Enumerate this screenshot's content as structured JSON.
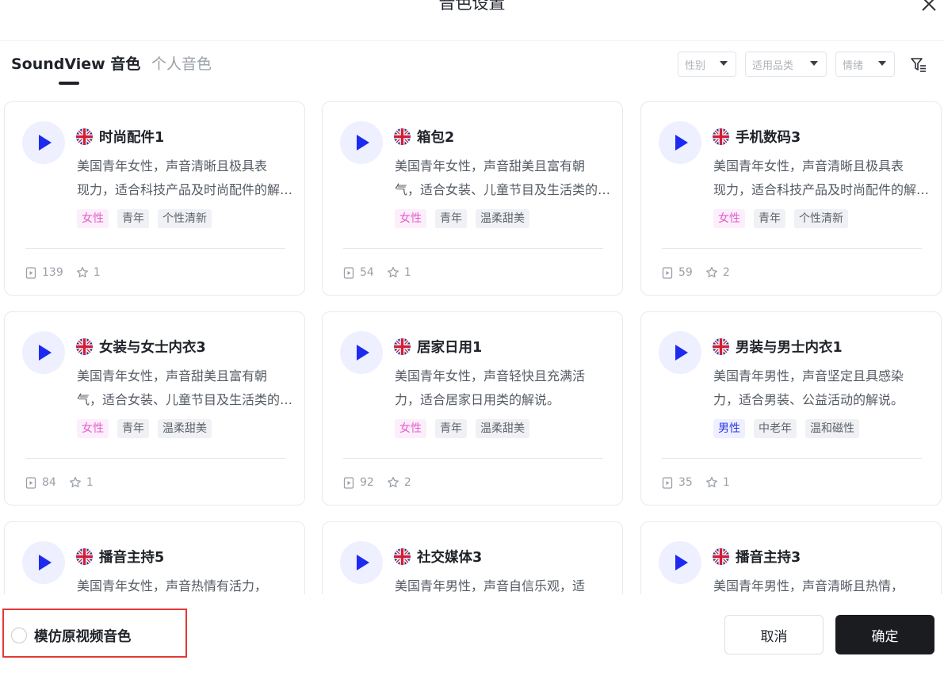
{
  "dialog": {
    "title": "音色设置"
  },
  "tabs": [
    {
      "label": "SoundView 音色",
      "active": true
    },
    {
      "label": "个人音色",
      "active": false
    }
  ],
  "filters": {
    "gender": "性别",
    "category": "适用品类",
    "emotion": "情绪",
    "clear_icon": "filter-clear-icon"
  },
  "voices": [
    {
      "name": "时尚配件1",
      "flag": "uk",
      "desc_lines": [
        "美国青年女性，声音清晰且极具表",
        "现力，适合科技产品及时尚配件的解说。"
      ],
      "tags": [
        {
          "text": "女性",
          "kind": "female"
        },
        {
          "text": "青年",
          "kind": "normal"
        },
        {
          "text": "个性清新",
          "kind": "normal"
        }
      ],
      "plays": "139",
      "favorites": "1"
    },
    {
      "name": "箱包2",
      "flag": "uk",
      "desc_lines": [
        "美国青年女性，声音甜美且富有朝",
        "气，适合女装、儿童节目及生活类的解说。"
      ],
      "tags": [
        {
          "text": "女性",
          "kind": "female"
        },
        {
          "text": "青年",
          "kind": "normal"
        },
        {
          "text": "温柔甜美",
          "kind": "normal"
        }
      ],
      "plays": "54",
      "favorites": "1"
    },
    {
      "name": "手机数码3",
      "flag": "uk",
      "desc_lines": [
        "美国青年女性，声音清晰且极具表",
        "现力，适合科技产品及时尚配件的解说。"
      ],
      "tags": [
        {
          "text": "女性",
          "kind": "female"
        },
        {
          "text": "青年",
          "kind": "normal"
        },
        {
          "text": "个性清新",
          "kind": "normal"
        }
      ],
      "plays": "59",
      "favorites": "2"
    },
    {
      "name": "女装与女士内衣3",
      "flag": "uk",
      "desc_lines": [
        "美国青年女性，声音甜美且富有朝",
        "气，适合女装、儿童节目及生活类的解说。"
      ],
      "tags": [
        {
          "text": "女性",
          "kind": "female"
        },
        {
          "text": "青年",
          "kind": "normal"
        },
        {
          "text": "温柔甜美",
          "kind": "normal"
        }
      ],
      "plays": "84",
      "favorites": "1"
    },
    {
      "name": "居家日用1",
      "flag": "uk",
      "desc_lines": [
        "美国青年女性，声音轻快且充满活",
        "力，适合居家日用类的解说。"
      ],
      "tags": [
        {
          "text": "女性",
          "kind": "female"
        },
        {
          "text": "青年",
          "kind": "normal"
        },
        {
          "text": "温柔甜美",
          "kind": "normal"
        }
      ],
      "plays": "92",
      "favorites": "2"
    },
    {
      "name": "男装与男士内衣1",
      "flag": "uk",
      "desc_lines": [
        "美国青年男性，声音坚定且具感染",
        "力，适合男装、公益活动的解说。"
      ],
      "tags": [
        {
          "text": "男性",
          "kind": "male"
        },
        {
          "text": "中老年",
          "kind": "normal"
        },
        {
          "text": "温和磁性",
          "kind": "normal"
        }
      ],
      "plays": "35",
      "favorites": "1"
    },
    {
      "name": "播音主持5",
      "flag": "uk",
      "desc_lines": [
        "美国青年女性，声音热情有活力，"
      ],
      "tags": [],
      "plays": "",
      "favorites": ""
    },
    {
      "name": "社交媒体3",
      "flag": "uk",
      "desc_lines": [
        "美国青年男性，声音自信乐观，适"
      ],
      "tags": [],
      "plays": "",
      "favorites": ""
    },
    {
      "name": "播音主持3",
      "flag": "uk",
      "desc_lines": [
        "美国青年男性，声音清晰且热情，"
      ],
      "tags": [],
      "plays": "",
      "favorites": ""
    }
  ],
  "footer": {
    "imitate_label": "模仿原视频音色",
    "cancel_label": "取消",
    "confirm_label": "确定"
  },
  "colors": {
    "accent": "#1d2bf0",
    "female_tag": "#e35fcb",
    "male_tag": "#2a35e8",
    "highlight_box": "#e53935",
    "primary_button": "#1b1c20"
  }
}
